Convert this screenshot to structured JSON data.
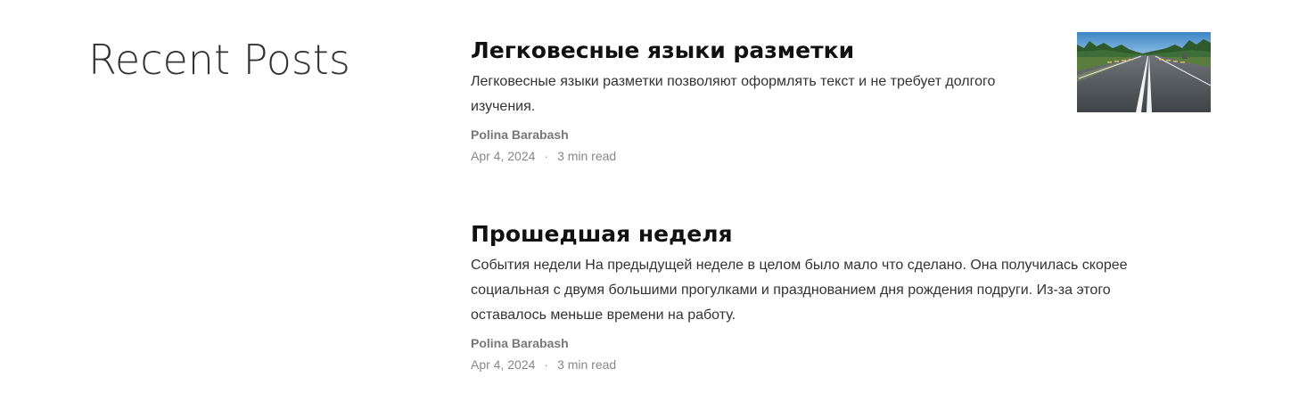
{
  "section": {
    "title": "Recent Posts"
  },
  "posts": [
    {
      "title": "Легковесные языки разметки",
      "excerpt": "Легковесные языки разметки позволяют оформлять текст и не требует долгого изучения.",
      "author": "Polina Barabash",
      "date": "Apr 4, 2024",
      "separator": "·",
      "read_time": "3 min read",
      "thumbnail": "road-photo"
    },
    {
      "title": "Прошедшая неделя",
      "excerpt": "События недели На предыдущей неделе в целом было мало что сделано. Она получилась скорее социальная с двумя большими прогулками и празднованием дня рождения подруги. Из-за этого оставалось меньше времени на работу.",
      "author": "Polina Barabash",
      "date": "Apr 4, 2024",
      "separator": "·",
      "read_time": "3 min read"
    }
  ]
}
